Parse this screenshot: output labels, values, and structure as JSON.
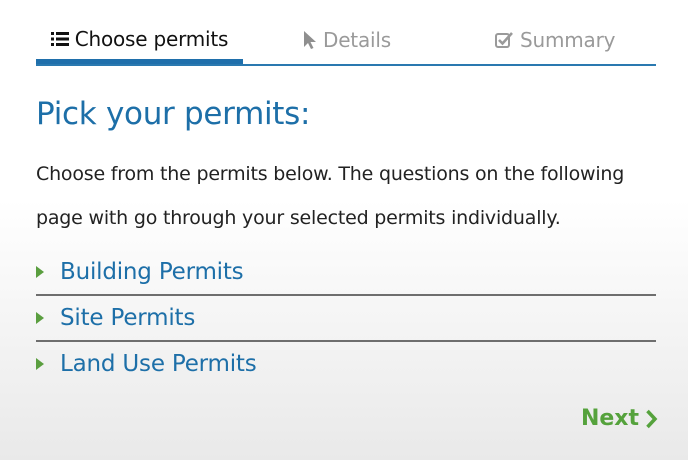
{
  "tabs": [
    {
      "label": "Choose permits",
      "icon": "list-icon",
      "state": "active"
    },
    {
      "label": "Details",
      "icon": "cursor-icon",
      "state": "inactive"
    },
    {
      "label": "Summary",
      "icon": "checkbox-icon",
      "state": "inactive"
    }
  ],
  "main": {
    "title": "Pick your permits:",
    "intro": "Choose from the permits below. The questions on the following page with go through your selected permits individually."
  },
  "permits": [
    {
      "label": "Building Permits",
      "icon": "caret-right-icon"
    },
    {
      "label": "Site Permits",
      "icon": "caret-right-icon"
    },
    {
      "label": "Land Use Permits",
      "icon": "caret-right-icon"
    }
  ],
  "footer": {
    "next_label": "Next",
    "next_icon": "chevron-right-icon"
  },
  "colors": {
    "primary": "#1d6fa8",
    "accent_green": "#55a23c",
    "inactive_tab": "#9a9a9a"
  }
}
